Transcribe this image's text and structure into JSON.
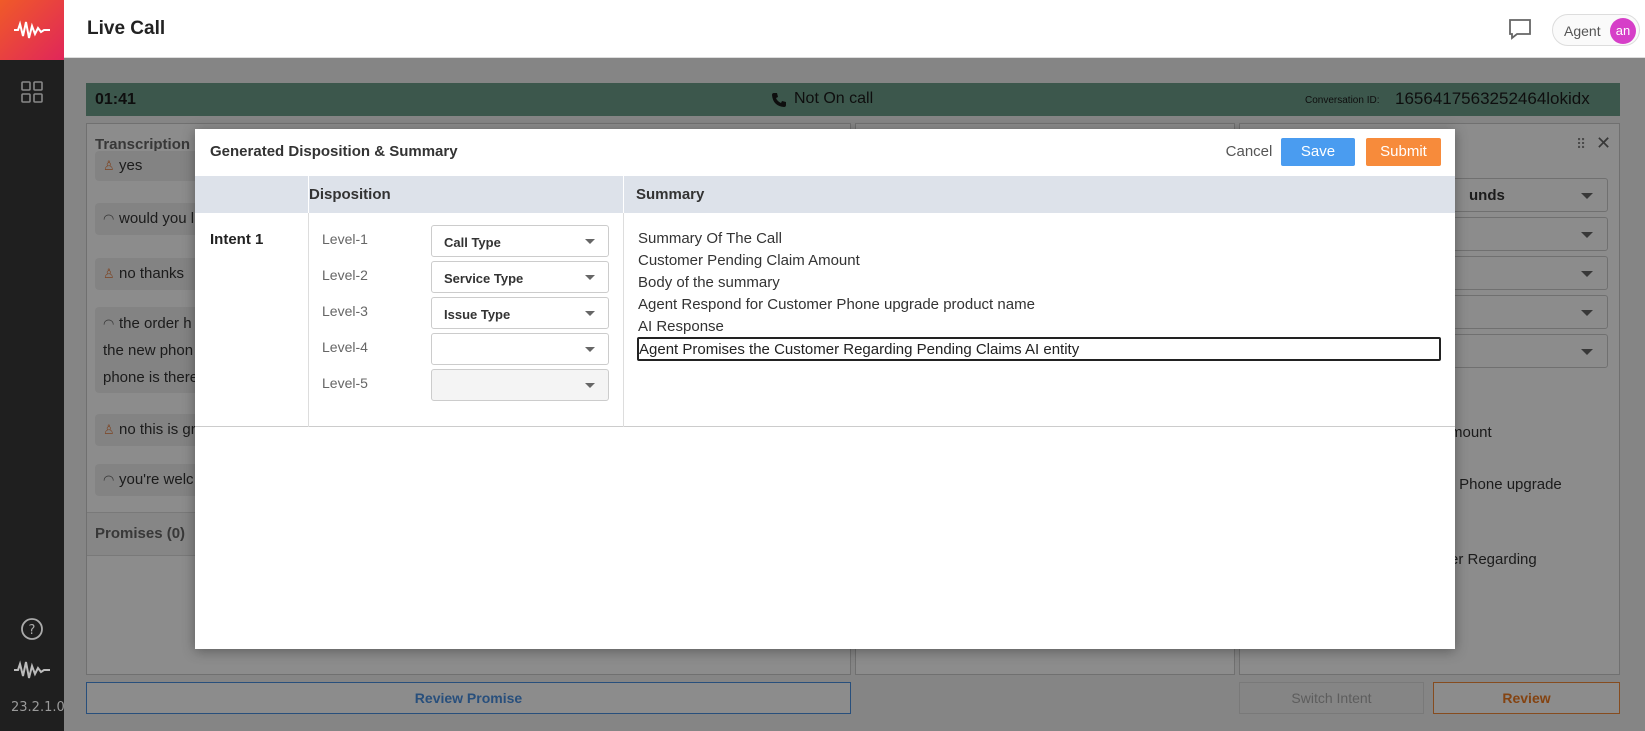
{
  "app": {
    "title": "Live Call",
    "version": "23.2.1.0"
  },
  "topbar": {
    "agent_label": "Agent",
    "avatar_initials": "an"
  },
  "status": {
    "timer": "01:41",
    "call_state": "Not On call",
    "conversation_label": "Conversation ID:",
    "conversation_id": "1656417563252464lokidx"
  },
  "transcription": {
    "title": "Transcription",
    "messages": [
      {
        "speaker": "customer",
        "text": "yes"
      },
      {
        "speaker": "agent",
        "text": "would you l"
      },
      {
        "speaker": "customer",
        "text": "no thanks"
      },
      {
        "speaker": "agent",
        "text": "the order h"
      },
      {
        "speaker": "agent",
        "text": "the new phon"
      },
      {
        "speaker": "agent",
        "text": "phone is there"
      },
      {
        "speaker": "customer",
        "text": "no this is gr"
      },
      {
        "speaker": "agent",
        "text": "you're welc"
      }
    ]
  },
  "promises": {
    "title": "Promises (0)",
    "review_button": "Review Promise"
  },
  "right_panel": {
    "first_select": "unds",
    "snippets": [
      "mount",
      "r Phone upgrade",
      "er Regarding"
    ],
    "switch_intent_button": "Switch Intent",
    "review_button": "Review"
  },
  "modal": {
    "title": "Generated Disposition & Summary",
    "cancel": "Cancel",
    "save": "Save",
    "submit": "Submit",
    "columns": {
      "disposition": "Disposition",
      "summary": "Summary"
    },
    "intent_label": "Intent 1",
    "levels": [
      {
        "label": "Level-1",
        "value": "Call Type"
      },
      {
        "label": "Level-2",
        "value": "Service Type"
      },
      {
        "label": "Level-3",
        "value": "Issue Type"
      },
      {
        "label": "Level-4",
        "value": ""
      },
      {
        "label": "Level-5",
        "value": ""
      }
    ],
    "summary_lines": [
      "Summary Of The Call",
      "Customer Pending Claim Amount",
      "Body of the summary",
      "Agent Respond for Customer Phone upgrade product name",
      "AI Response"
    ],
    "summary_edit_value": "Agent Promises the Customer Regarding Pending Claims AI entity"
  },
  "icons": {
    "brand": "waveform-logo-icon",
    "apps": "grid-icon",
    "help": "help-circle-icon",
    "chat": "chat-bubble-icon",
    "phone": "phone-icon",
    "close": "close-icon",
    "drag": "drag-handle-icon"
  },
  "colors": {
    "brand_gradient_start": "#f05a28",
    "brand_gradient_end": "#e0265a",
    "save": "#4a9cf0",
    "submit": "#f78b3b",
    "status_bar": "#6e9e8a"
  }
}
